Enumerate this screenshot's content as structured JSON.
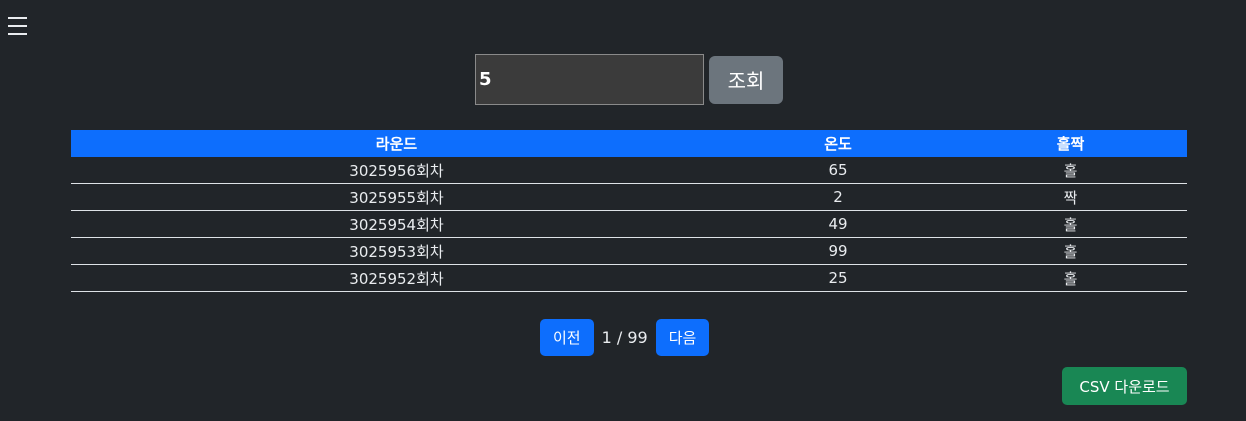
{
  "search": {
    "value": "5",
    "button_label": "조회"
  },
  "table": {
    "headers": [
      "라운드",
      "온도",
      "홀짝"
    ],
    "rows": [
      [
        "3025956회차",
        "65",
        "홀"
      ],
      [
        "3025955회차",
        "2",
        "짝"
      ],
      [
        "3025954회차",
        "49",
        "홀"
      ],
      [
        "3025953회차",
        "99",
        "홀"
      ],
      [
        "3025952회차",
        "25",
        "홀"
      ]
    ]
  },
  "pagination": {
    "prev_label": "이전",
    "page_info": "1 / 99",
    "next_label": "다음"
  },
  "csv_button_label": "CSV 다운로드",
  "colors": {
    "background": "#212529",
    "header_blue": "#0d6efd",
    "search_button_gray": "#6c757d",
    "csv_green": "#198754"
  },
  "icons": {
    "menu": "hamburger-menu-icon"
  }
}
